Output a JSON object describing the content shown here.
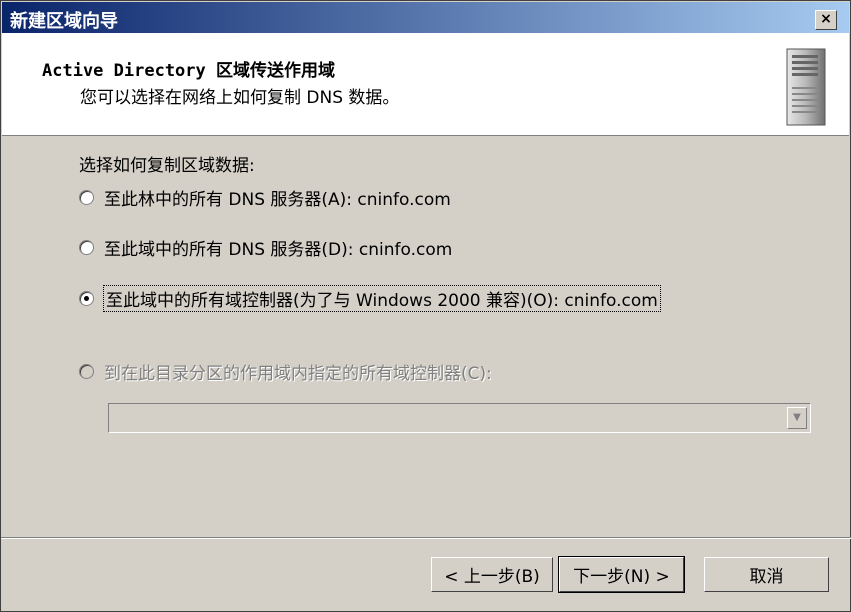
{
  "window": {
    "title": "新建区域向导",
    "close_label": "×"
  },
  "header": {
    "title": "Active Directory 区域传送作用域",
    "subtitle": "您可以选择在网络上如何复制 DNS 数据。",
    "icon": "server-icon"
  },
  "content": {
    "prompt": "选择如何复制区域数据:",
    "options": [
      {
        "label": "至此林中的所有 DNS 服务器(A): cninfo.com",
        "checked": false,
        "enabled": true
      },
      {
        "label": "至此域中的所有 DNS 服务器(D): cninfo.com",
        "checked": false,
        "enabled": true
      },
      {
        "label": "至此域中的所有域控制器(为了与 Windows 2000 兼容)(O): cninfo.com",
        "checked": true,
        "enabled": true
      },
      {
        "label": "到在此目录分区的作用域内指定的所有域控制器(C):",
        "checked": false,
        "enabled": false
      }
    ],
    "partition_combo_value": ""
  },
  "buttons": {
    "back": "< 上一步(B)",
    "next": "下一步(N) >",
    "cancel": "取消"
  }
}
